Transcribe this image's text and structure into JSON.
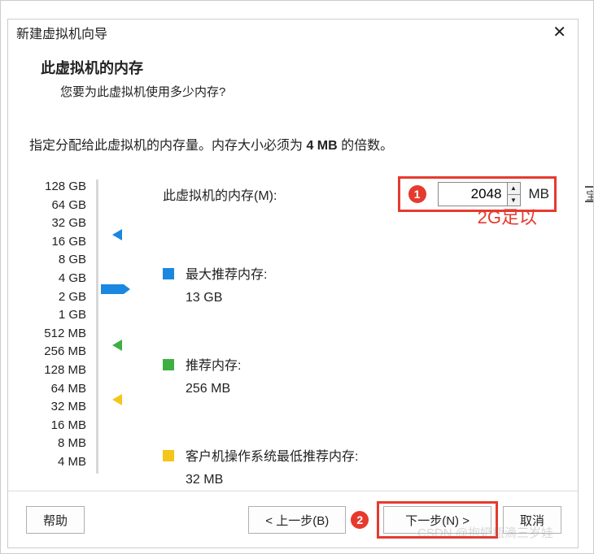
{
  "window": {
    "title": "新建虚拟机向导"
  },
  "header": {
    "title": "此虚拟机的内存",
    "subtitle": "您要为此虚拟机使用多少内存?"
  },
  "instruction": {
    "pre": "指定分配给此虚拟机的内存量。内存大小必须为 ",
    "bold": "4 MB",
    "post": " 的倍数。"
  },
  "memory": {
    "label": "此虚拟机的内存(M):",
    "value": "2048",
    "unit": "MB"
  },
  "ticks": [
    "128 GB",
    "64 GB",
    "32 GB",
    "16 GB",
    "8 GB",
    "4 GB",
    "2 GB",
    "1 GB",
    "512 MB",
    "256 MB",
    "128 MB",
    "64 MB",
    "32 MB",
    "16 MB",
    "8 MB",
    "4 MB"
  ],
  "pointers": {
    "max": {
      "tick_index": 3,
      "color": "#1a87e0"
    },
    "cur": {
      "tick_index": 6
    },
    "rec": {
      "tick_index": 9,
      "color": "#3cb043"
    },
    "min": {
      "tick_index": 12,
      "color": "#f5c518"
    }
  },
  "reco": {
    "max": {
      "label": "最大推荐内存:",
      "value": "13 GB",
      "color": "#1a87e0"
    },
    "rec": {
      "label": "推荐内存:",
      "value": "256 MB",
      "color": "#3cb043"
    },
    "min": {
      "label": "客户机操作系统最低推荐内存:",
      "value": "32 MB",
      "color": "#f5c518"
    }
  },
  "annot": {
    "badge1": "1",
    "text": "2G足以",
    "badge2": "2"
  },
  "buttons": {
    "help": "帮助",
    "back": "< 上一步(B)",
    "next": "下一步(N) >",
    "cancel": "取消"
  },
  "watermark": "CSDN @抱奶瓶滴三岁娃",
  "stub": "宝"
}
